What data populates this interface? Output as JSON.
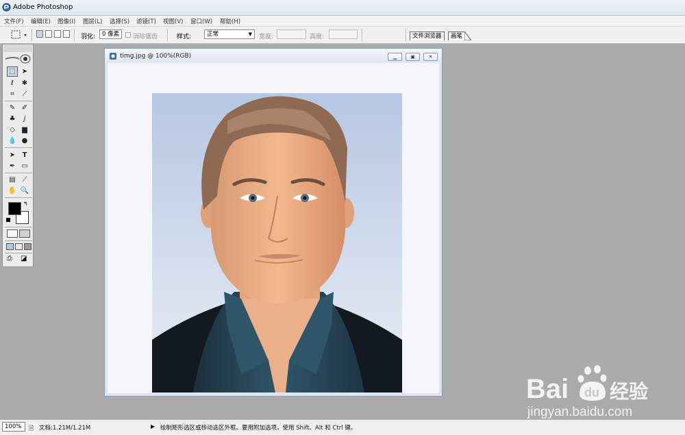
{
  "app": {
    "title": "Adobe Photoshop"
  },
  "menu": [
    "文件(F)",
    "编辑(E)",
    "图像(I)",
    "图层(L)",
    "选择(S)",
    "滤镜(T)",
    "视图(V)",
    "窗口(W)",
    "帮助(H)"
  ],
  "options": {
    "feather_label": "羽化:",
    "feather_value": "0 像素",
    "antialias_label": "消除锯齿",
    "style_label": "样式:",
    "style_value": "正常",
    "width_label": "宽度:",
    "height_label": "高度:"
  },
  "palette_tabs": [
    "文件浏览器",
    "画笔"
  ],
  "document": {
    "title": "timg.jpg @ 100%(RGB)"
  },
  "status": {
    "zoom": "100%",
    "doc_info": "文档:1.21M/1.21M",
    "hint": "绘制矩形选区或移动选区外框。要用附加选项，使用 Shift、Alt 和 Ctrl 键。"
  },
  "watermark": {
    "brand": "Bai",
    "brand2": "经验",
    "url": "jingyan.baidu.com"
  },
  "colors": {
    "foreground": "#000000",
    "background": "#ffffff",
    "accent": "#c8d4e6"
  }
}
